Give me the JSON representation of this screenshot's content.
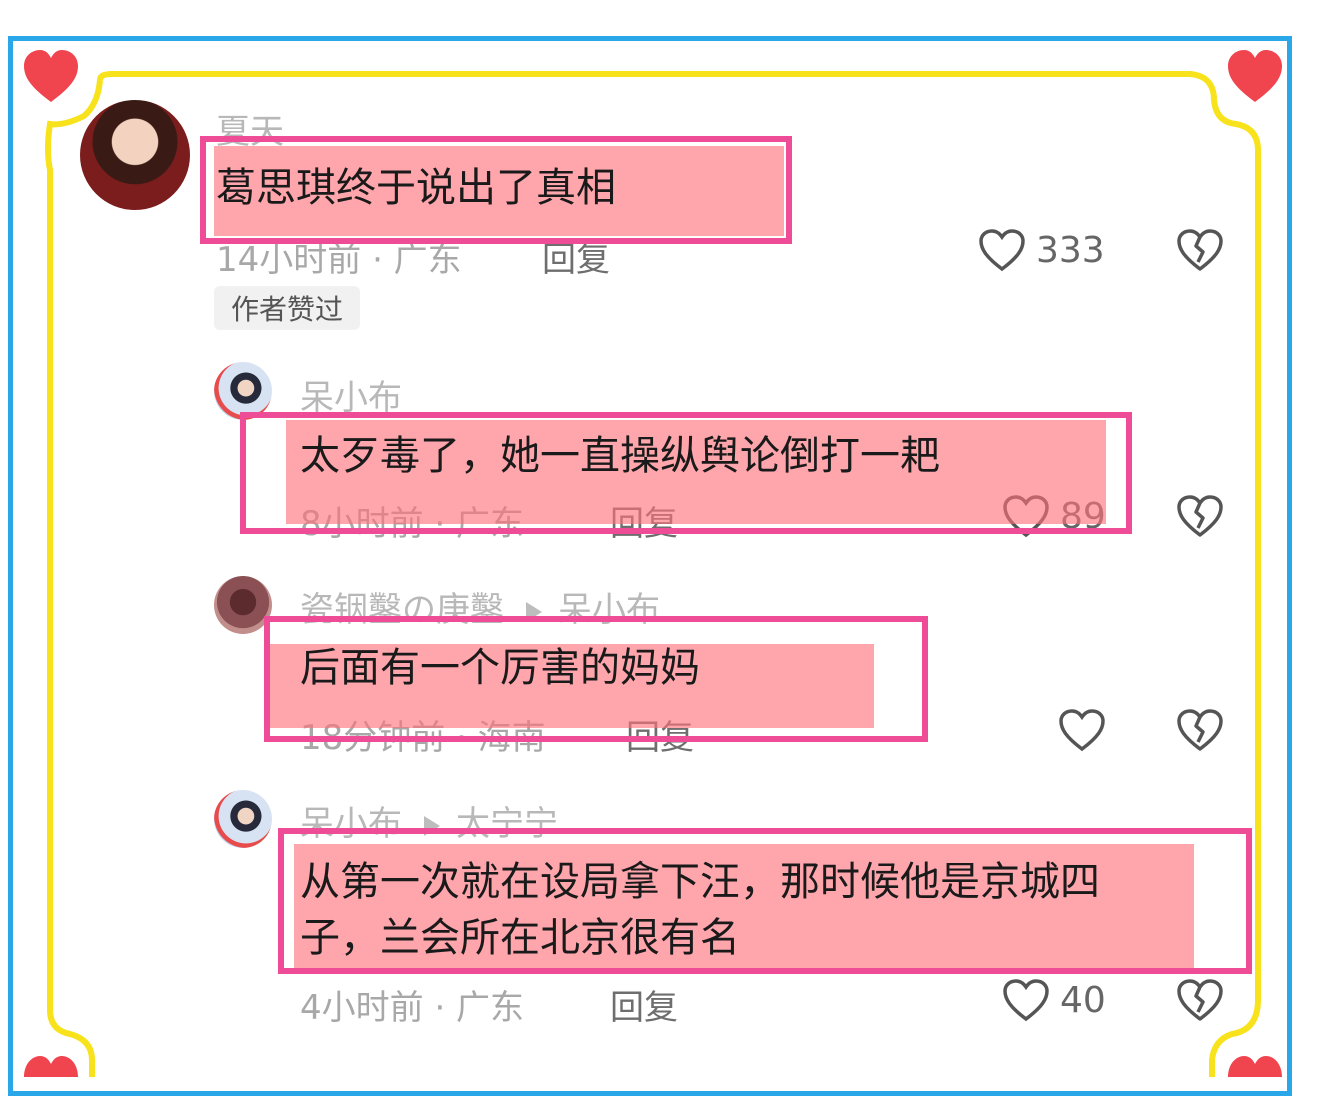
{
  "comments": [
    {
      "username": "夏天",
      "text": "葛思琪终于说出了真相",
      "meta": "14小时前 · 广东",
      "reply_label": "回复",
      "likes": "333",
      "badge": "作者赞过"
    },
    {
      "username": "呆小布",
      "text": "太歹毒了，她一直操纵舆论倒打一耙",
      "meta": "8小时前 · 广东",
      "reply_label": "回复",
      "likes": "89"
    },
    {
      "username": "瓷铟鑿の庚鑿",
      "reply_to": "呆小布",
      "text": "后面有一个厉害的妈妈",
      "meta": "18分钟前 · 海南",
      "reply_label": "回复",
      "likes": ""
    },
    {
      "username": "呆小布",
      "reply_to": "太宁宁",
      "text_line1": "从第一次就在设局拿下汪，那时候他是京城四",
      "text_line2": "子，兰会所在北京很有名",
      "meta": "4小时前 · 广东",
      "reply_label": "回复",
      "likes": "40"
    }
  ],
  "colors": {
    "frame_blue": "#2aa7e8",
    "frame_yellow": "#f7e21b",
    "heart_red": "#f0454f",
    "highlight_fill": "#ff707a",
    "highlight_border": "#ef4c98"
  },
  "icons": [
    "heart-outline-icon",
    "broken-heart-icon",
    "corner-heart-icon"
  ]
}
